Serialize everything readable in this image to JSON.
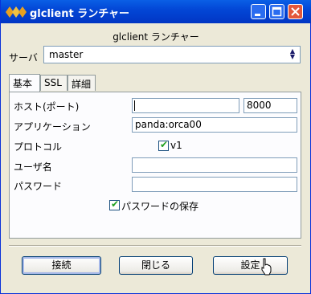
{
  "window": {
    "title": "glclient ランチャー",
    "controls": {
      "minimize": "minimize-icon",
      "maximize": "maximize-icon",
      "close": "close-icon"
    }
  },
  "heading": "glclient ランチャー",
  "server": {
    "label": "サーバ",
    "value": "master"
  },
  "tabs": [
    {
      "label": "基本",
      "active": true
    },
    {
      "label": "SSL",
      "active": false
    },
    {
      "label": "詳細",
      "active": false
    }
  ],
  "form": {
    "host_label": "ホスト(ポート)",
    "host_value": "",
    "port_value": "8000",
    "app_label": "アプリケーション",
    "app_value": "panda:orca00",
    "protocol_label": "プロトコル",
    "protocol_option": "v1",
    "protocol_checked": true,
    "user_label": "ユーザ名",
    "user_value": "",
    "password_label": "パスワード",
    "password_value": "",
    "save_password_label": "パスワードの保存",
    "save_password_checked": true
  },
  "buttons": {
    "connect": "接続",
    "close": "閉じる",
    "settings": "設定"
  },
  "colors": {
    "titlebar": "#0347d6",
    "face": "#ece9d8",
    "check": "#21a121"
  }
}
